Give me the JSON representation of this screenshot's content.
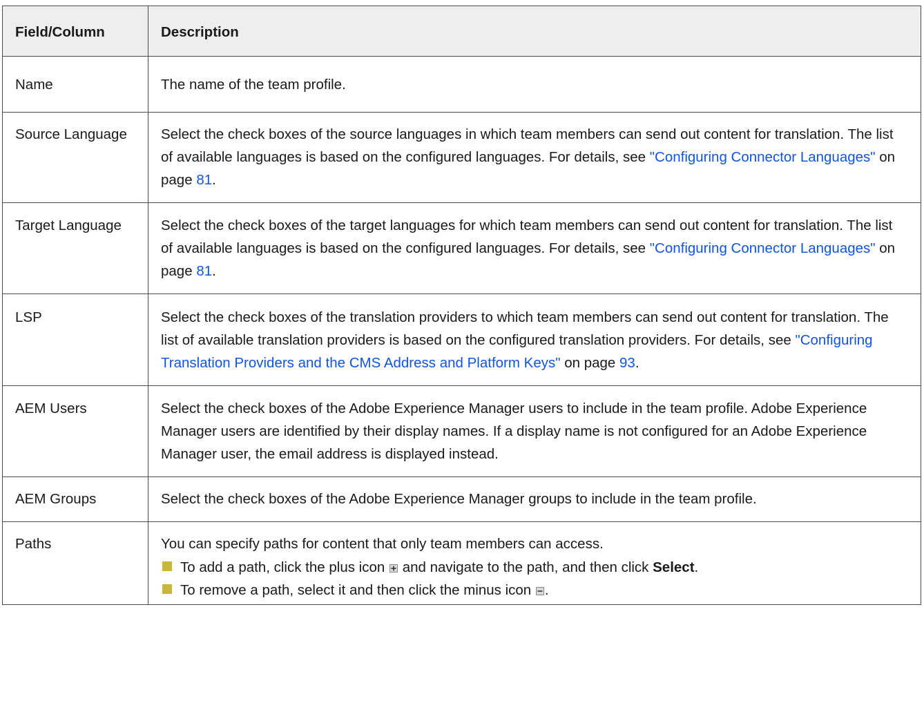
{
  "headers": {
    "field": "Field/Column",
    "description": "Description"
  },
  "rows": {
    "name": {
      "field": "Name",
      "desc": "The name of the team profile."
    },
    "source": {
      "field": "Source Language",
      "desc_pre": "Select the check boxes of the source languages in which team members can send out content for translation. The list of available languages is based on the configured languages. For details, see ",
      "link": "\"Configuring Connector Languages\"",
      "on_page": " on page ",
      "page": "81",
      "end": "."
    },
    "target": {
      "field": "Target Language",
      "desc_pre": "Select the check boxes of the target languages for which team members can send out content for translation. The list of available languages is based on the configured languages. For details, see ",
      "link": "\"Configuring Connector Languages\"",
      "on_page": " on page ",
      "page": "81",
      "end": "."
    },
    "lsp": {
      "field": "LSP",
      "desc_pre": "Select the check boxes of the translation providers to which team members can send out content for translation. The list of available translation providers is based on the configured translation providers. For details, see ",
      "link": "\"Configuring Translation Providers and the CMS Address and Platform Keys\"",
      "on_page": " on page ",
      "page": "93",
      "end": "."
    },
    "aem_users": {
      "field": "AEM Users",
      "desc": "Select the check boxes of the Adobe Experience Manager users to include in the team profile. Adobe Experience Manager users are identified by their display names. If a display name is not configured for an Adobe Experience Manager user, the email address is displayed instead."
    },
    "aem_groups": {
      "field": "AEM Groups",
      "desc": "Select the check boxes of the Adobe Experience Manager groups to include in the team profile."
    },
    "paths": {
      "field": "Paths",
      "intro": "You can specify paths for content that only team members can access.",
      "b1_pre": "To add a path, click the plus icon ",
      "b1_mid": " and navigate to the path, and then click ",
      "b1_bold": "Select",
      "b1_end": ".",
      "b2_pre": "To remove a path, select it and then click the minus icon ",
      "b2_end": "."
    }
  },
  "colors": {
    "link": "#1155dd",
    "bullet": "#c9b53a",
    "header_bg": "#eeeeee",
    "border": "#4a4a4a"
  },
  "icons": {
    "plus": "plus-box-icon",
    "minus": "minus-box-icon",
    "bullet": "square-bullet-icon"
  }
}
